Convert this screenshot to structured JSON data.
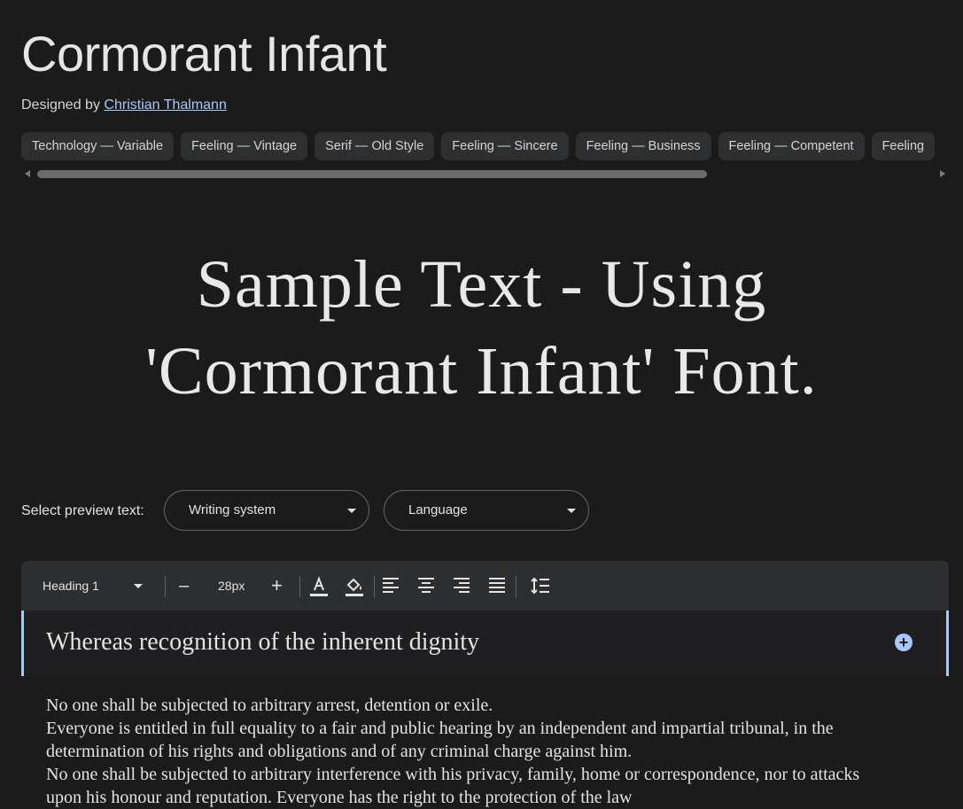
{
  "header": {
    "title": "Cormorant Infant",
    "designed_by_prefix": "Designed by",
    "designer_name": "Christian Thalmann"
  },
  "tags": [
    "Technology — Variable",
    "Feeling — Vintage",
    "Serif — Old Style",
    "Feeling — Sincere",
    "Feeling — Business",
    "Feeling — Competent",
    "Feeling"
  ],
  "sample_text": {
    "line1": "Sample Text - Using",
    "line2": "'Cormorant Infant' Font."
  },
  "preview": {
    "label": "Select preview text:",
    "writing_system": "Writing system",
    "language": "Language"
  },
  "toolbar": {
    "style_select": "Heading 1",
    "minus": "–",
    "size": "28px",
    "plus": "+"
  },
  "editor": {
    "heading": "Whereas recognition of the inherent dignity",
    "add_icon": "+",
    "paragraphs": [
      "No one shall be subjected to arbitrary arrest, detention or exile.",
      "Everyone is entitled in full equality to a fair and public hearing by an independent and impartial tribunal, in the determination of his rights and obligations and of any criminal charge against him.",
      "No one shall be subjected to arbitrary interference with his privacy, family, home or correspondence, nor to attacks upon his honour and reputation. Everyone has the right to the protection of the law"
    ]
  },
  "colors": {
    "background": "#1b1b1c",
    "chip": "#2e2f31",
    "accent": "#a8c7fa",
    "toolbar": "#2d2e30"
  }
}
